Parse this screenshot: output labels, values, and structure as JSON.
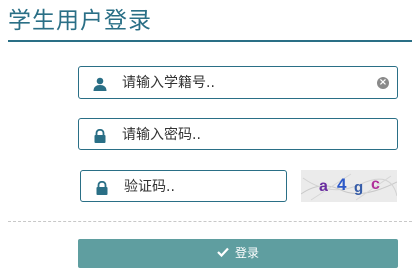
{
  "header": {
    "title": "学生用户登录"
  },
  "form": {
    "username_placeholder": "请输入学籍号..",
    "password_placeholder": "请输入密码..",
    "captcha_placeholder": "验证码..",
    "captcha_text": "a4gc"
  },
  "login_button": {
    "label": "登录"
  },
  "colors": {
    "accent": "#2a6f86",
    "button": "#5f9ea0"
  },
  "icons": [
    "user-icon",
    "clear-icon",
    "lock-icon",
    "check-icon"
  ]
}
